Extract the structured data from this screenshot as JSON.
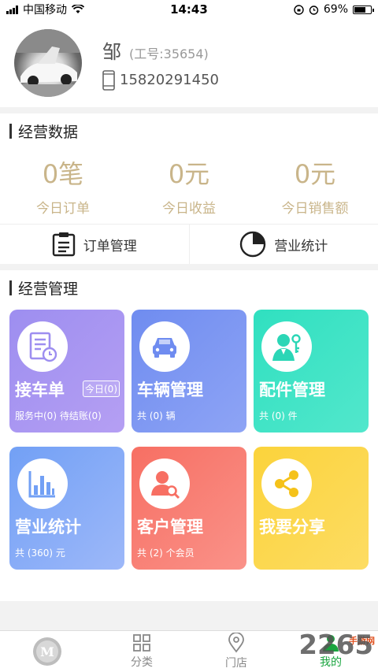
{
  "status": {
    "carrier": "中国移动",
    "time": "14:43",
    "battery": "69%",
    "battery_level": 0.69
  },
  "profile": {
    "name": "邹",
    "id": "(工号:35654)",
    "phone": "15820291450"
  },
  "business_data": {
    "title": "经营数据",
    "stats": [
      {
        "value": "0笔",
        "label": "今日订单"
      },
      {
        "value": "0元",
        "label": "今日收益"
      },
      {
        "value": "0元",
        "label": "今日销售额"
      }
    ],
    "links": [
      {
        "label": "订单管理",
        "icon": "clipboard-icon"
      },
      {
        "label": "营业统计",
        "icon": "pie-chart-icon"
      }
    ]
  },
  "management": {
    "title": "经营管理",
    "cards": [
      {
        "title": "接车单",
        "sub": "服务中(0)  待结账(0)",
        "badge": "今日(0)",
        "icon": "order-form-icon",
        "color": "#9d8ef0"
      },
      {
        "title": "车辆管理",
        "sub": "共 (0) 辆",
        "icon": "car-icon",
        "color": "#6f8cf0"
      },
      {
        "title": "配件管理",
        "sub": "共 (0) 件",
        "icon": "person-key-icon",
        "color": "#30e0c0"
      },
      {
        "title": "营业统计",
        "sub": "共 (360) 元",
        "icon": "bar-chart-icon",
        "color": "#72a0f5"
      },
      {
        "title": "客户管理",
        "sub": "共 (2) 个会员",
        "icon": "customer-search-icon",
        "color": "#f76f63"
      },
      {
        "title": "我要分享",
        "sub": "",
        "icon": "share-icon",
        "color": "#fbd33b"
      }
    ]
  },
  "tabbar": {
    "items": [
      {
        "label": "",
        "icon": "logo-icon"
      },
      {
        "label": "分类",
        "icon": "grid-icon"
      },
      {
        "label": "门店",
        "icon": "location-pin-icon"
      },
      {
        "label": "我的",
        "icon": "user-icon"
      }
    ],
    "active_color": "#1aa53f"
  },
  "watermark": {
    "text": "2265",
    "sub": "手游网"
  }
}
